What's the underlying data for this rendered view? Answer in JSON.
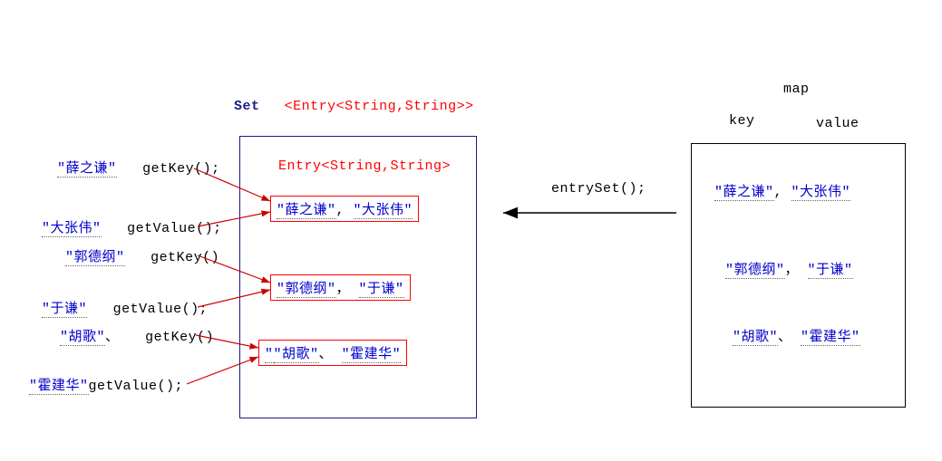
{
  "titles": {
    "set_label": "Set",
    "set_type": "<Entry<String,String>>",
    "entry_type": "Entry<String,String>",
    "map_label": "map",
    "key_header": "key",
    "value_header": "value",
    "entryset_call": "entrySet();"
  },
  "left_calls": {
    "r1_val": "\"薛之谦\"",
    "r1_fn": "getKey();",
    "r2_val": "\"大张伟\"",
    "r2_fn": "getValue();",
    "r3_val": "\"郭德纲\"",
    "r3_fn": "getKey()",
    "r4_val": "\"于谦\"",
    "r4_fn": "getValue();",
    "r5_val": "\"胡歌\"",
    "r5_fn": "getKey()",
    "r5_sep": "、",
    "r6_val": "\"霍建华\"",
    "r6_fn": "getValue();"
  },
  "entries": {
    "e1_k": "\"薛之谦\"",
    "e1_sep": ",",
    "e1_v": "\"大张伟\"",
    "e2_k": "\"郭德纲\"",
    "e2_sep": "，",
    "e2_v": "\"于谦\"",
    "e3_k": "\"胡歌\"",
    "e3_sep": "、",
    "e3_v": "\"霍建华\"",
    "lead3": "\""
  },
  "map_pairs": {
    "p1_k": "\"薛之谦\"",
    "p1_sep": ",",
    "p1_v": "\"大张伟\"",
    "p2_k": "\"郭德纲\"",
    "p2_sep": "，",
    "p2_v": "\"于谦\"",
    "p3_k": "\"胡歌\"",
    "p3_sep": "、",
    "p3_v": "\"霍建华\""
  }
}
